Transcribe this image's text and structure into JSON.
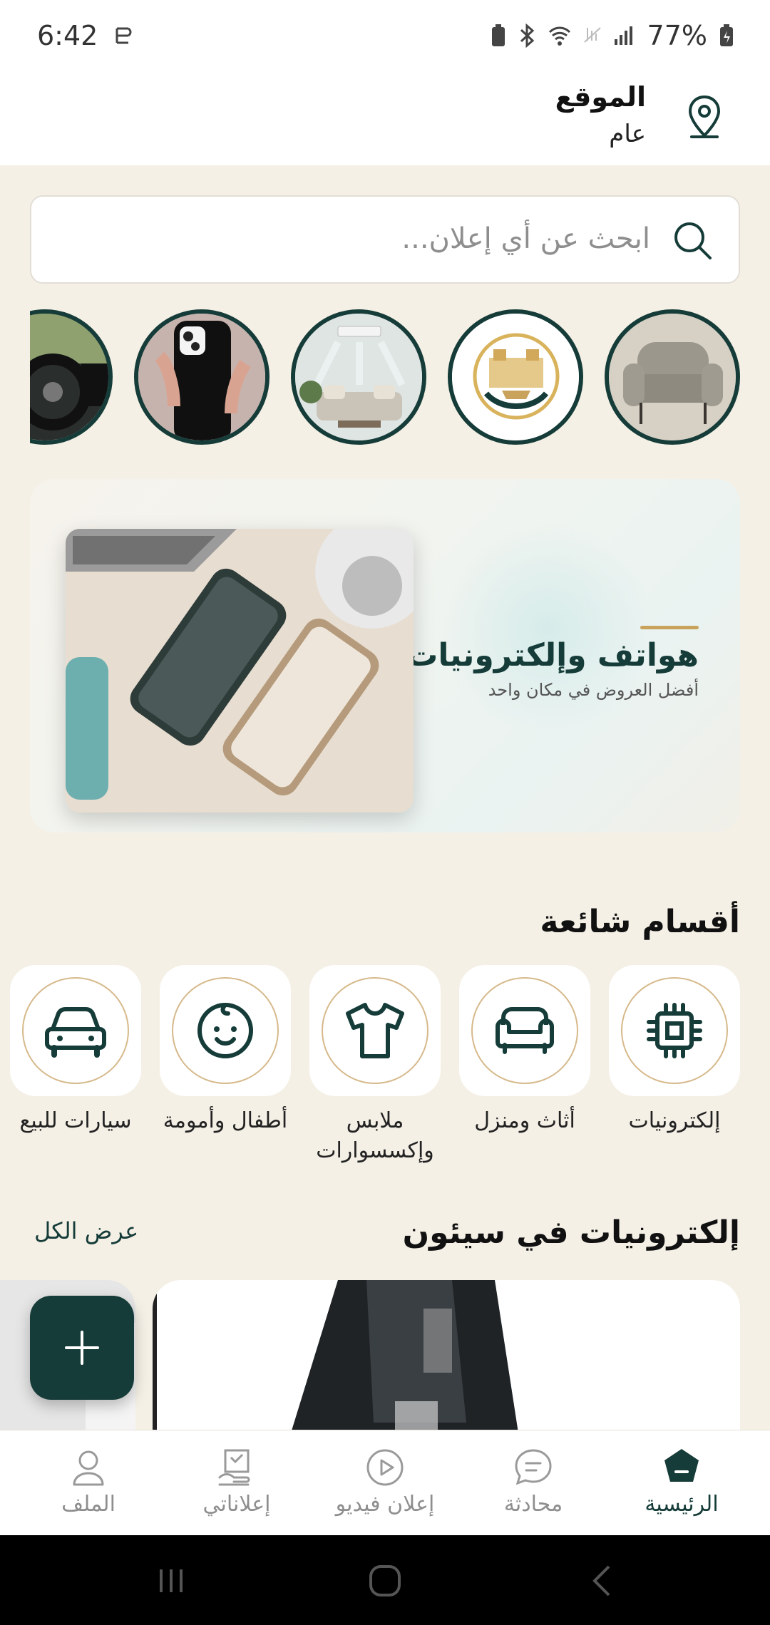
{
  "status_bar": {
    "time": "6:42",
    "battery": "77%"
  },
  "header": {
    "location_title": "الموقع",
    "location_value": "عام"
  },
  "search": {
    "placeholder": "ابحث عن أي إعلان..."
  },
  "stories": [
    {
      "name": "story-furniture"
    },
    {
      "name": "story-logo"
    },
    {
      "name": "story-living-room"
    },
    {
      "name": "story-phone"
    },
    {
      "name": "story-car"
    }
  ],
  "banner": {
    "title": "هواتف وإلكترونيات",
    "subtitle": "أفضل العروض في مكان واحد"
  },
  "popular": {
    "title": "أقسام شائعة",
    "categories": [
      {
        "label": "إلكترونيات",
        "icon": "chip-icon"
      },
      {
        "label": "أثاث ومنزل",
        "icon": "sofa-icon"
      },
      {
        "label": "ملابس وإكسسوارات",
        "icon": "tshirt-icon"
      },
      {
        "label": "أطفال وأمومة",
        "icon": "baby-icon"
      },
      {
        "label": "سيارات للبيع",
        "icon": "car-icon"
      }
    ]
  },
  "season": {
    "title": "إلكترونيات في سيئون",
    "view_all": "عرض الكل"
  },
  "bottom_nav": [
    {
      "label": "الرئيسية",
      "icon": "home-icon",
      "active": true
    },
    {
      "label": "محادثة",
      "icon": "chat-icon",
      "active": false
    },
    {
      "label": "إعلان فيديو",
      "icon": "play-icon",
      "active": false
    },
    {
      "label": "إعلاناتي",
      "icon": "my-ads-icon",
      "active": false
    },
    {
      "label": "الملف",
      "icon": "profile-icon",
      "active": false
    }
  ],
  "colors": {
    "primary": "#153c38",
    "accent": "#c9a25c",
    "background": "#f5f0e6"
  }
}
